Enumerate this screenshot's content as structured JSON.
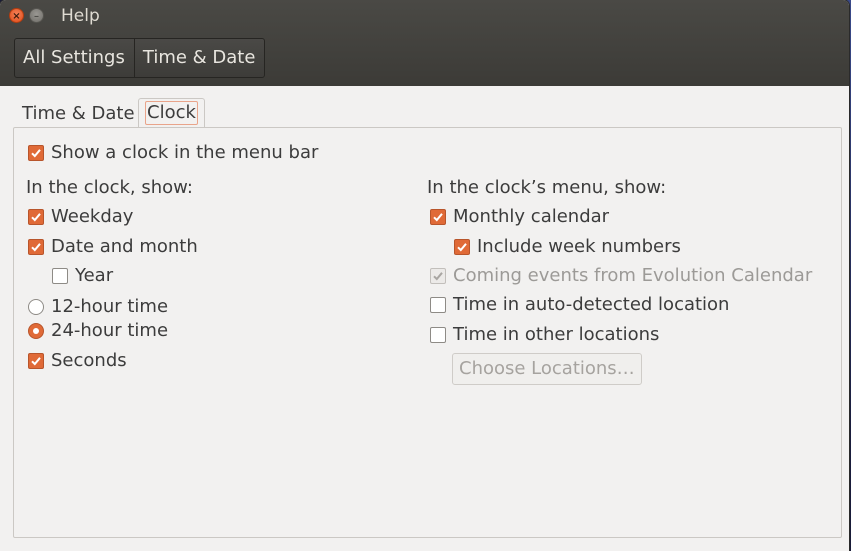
{
  "window": {
    "title": "Help",
    "close_symbol": "×",
    "minimize_symbol": "–"
  },
  "navigation": {
    "crumbs": [
      "All Settings",
      "Time & Date"
    ]
  },
  "tabs": [
    {
      "label": "Time & Date",
      "selected": false
    },
    {
      "label": "Clock",
      "selected": true
    }
  ],
  "clock": {
    "show_clock": {
      "label": "Show a clock in the menu bar",
      "checked": true
    },
    "left": {
      "heading": "In the clock, show:",
      "weekday": {
        "label": "Weekday",
        "checked": true
      },
      "date_month": {
        "label": "Date and month",
        "checked": true
      },
      "year": {
        "label": "Year",
        "checked": false
      },
      "hour12": {
        "label": "12-hour time",
        "selected": false
      },
      "hour24": {
        "label": "24-hour time",
        "selected": true
      },
      "seconds": {
        "label": "Seconds",
        "checked": true
      }
    },
    "right": {
      "heading": "In the clock’s menu, show:",
      "monthly_calendar": {
        "label": "Monthly calendar",
        "checked": true
      },
      "week_numbers": {
        "label": "Include week numbers",
        "checked": true
      },
      "coming_events": {
        "label": "Coming events from Evolution Calendar",
        "checked": true,
        "disabled": true
      },
      "auto_location": {
        "label": "Time in auto-detected location",
        "checked": false
      },
      "other_locations": {
        "label": "Time in other locations",
        "checked": false
      },
      "choose_locations_button": "Choose Locations…"
    }
  },
  "colors": {
    "accent": "#e06a37",
    "titlebar": "#3c3b37",
    "background": "#f2f1f0"
  },
  "icons": {
    "checkmark": "check-icon",
    "close": "close-icon",
    "minimize": "minimize-icon"
  }
}
